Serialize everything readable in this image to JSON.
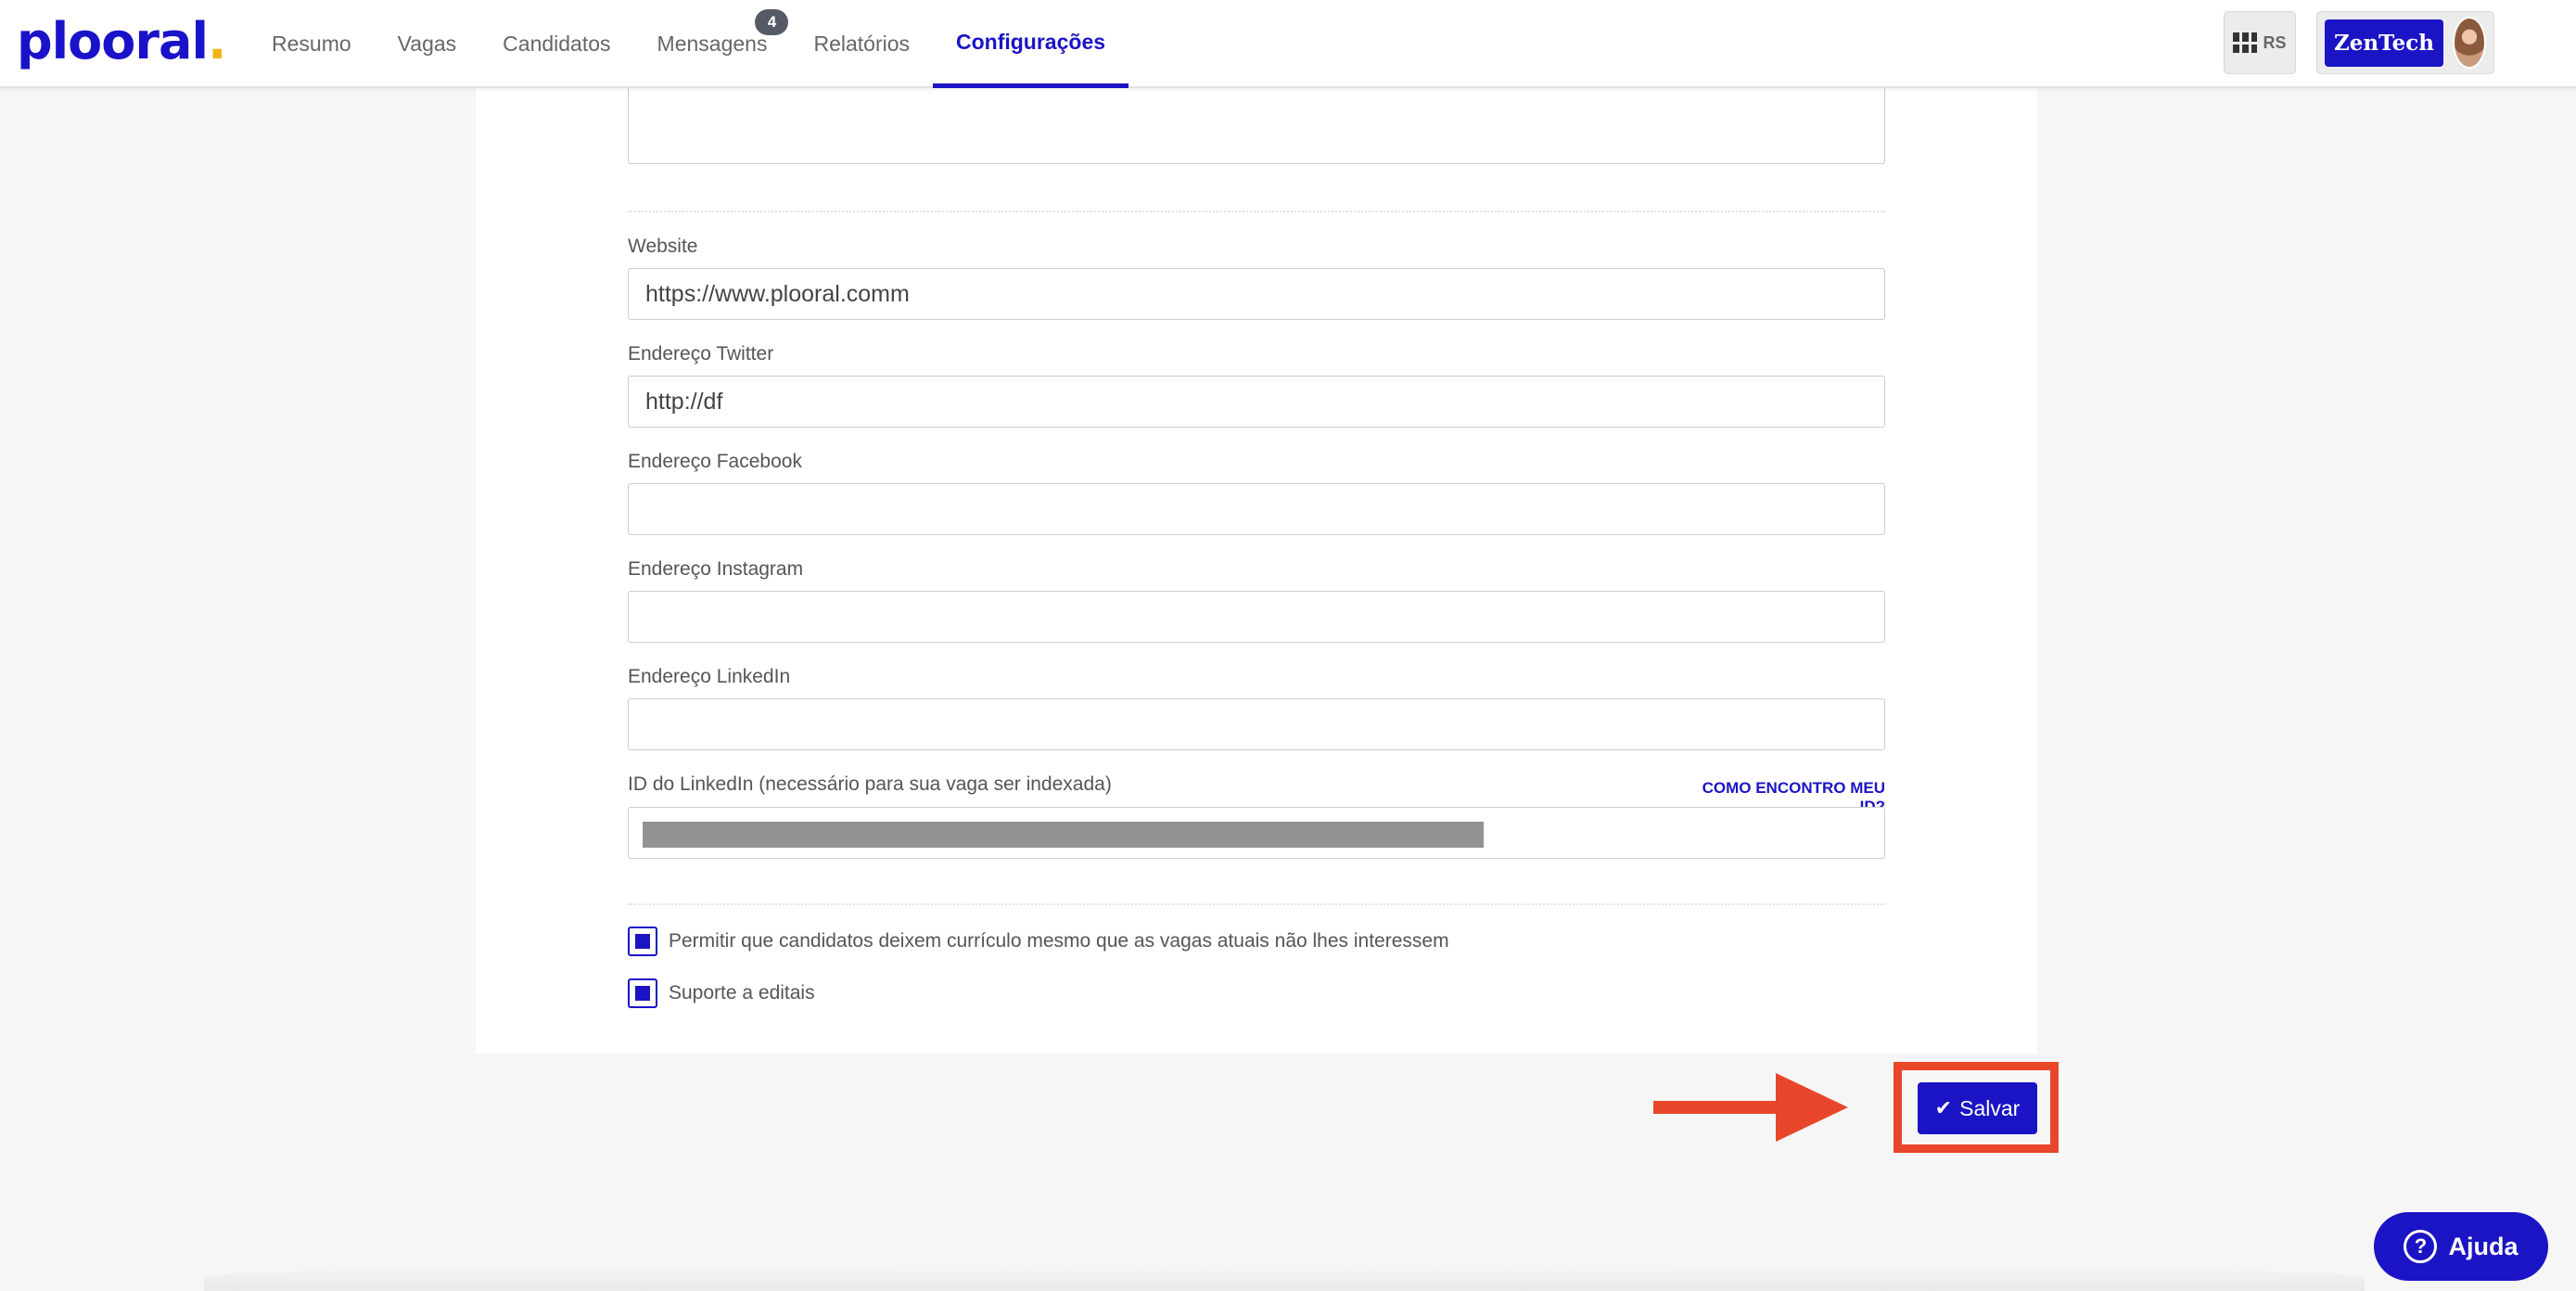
{
  "brand": {
    "logo_text": "plooral",
    "logo_main": "ploo",
    "logo_tail": "ral",
    "accent": "#1b14c4",
    "highlight": "#e8462a"
  },
  "nav": {
    "items": [
      {
        "label": "Resumo"
      },
      {
        "label": "Vagas"
      },
      {
        "label": "Candidatos"
      },
      {
        "label": "Mensagens",
        "badge": "4"
      },
      {
        "label": "Relatórios"
      },
      {
        "label": "Configurações",
        "active": true
      }
    ]
  },
  "header": {
    "apps_label": "RS",
    "company": "ZenTech"
  },
  "form": {
    "website": {
      "label": "Website",
      "value": "https://www.plooral.comm"
    },
    "twitter": {
      "label": "Endereço Twitter",
      "value": "http://df"
    },
    "facebook": {
      "label": "Endereço Facebook",
      "value": ""
    },
    "instagram": {
      "label": "Endereço Instagram",
      "value": ""
    },
    "linkedin": {
      "label": "Endereço LinkedIn",
      "value": ""
    },
    "linkedin_id": {
      "label": "ID do LinkedIn (necessário para sua vaga ser indexada)",
      "help_link": "COMO ENCONTRO MEU ID?"
    },
    "options": [
      {
        "label": "Permitir que candidatos deixem currículo mesmo que as vagas atuais não lhes interessem",
        "checked": true
      },
      {
        "label": "Suporte a editais",
        "checked": true
      }
    ]
  },
  "actions": {
    "save_label": "Salvar"
  },
  "help": {
    "label": "Ajuda"
  }
}
